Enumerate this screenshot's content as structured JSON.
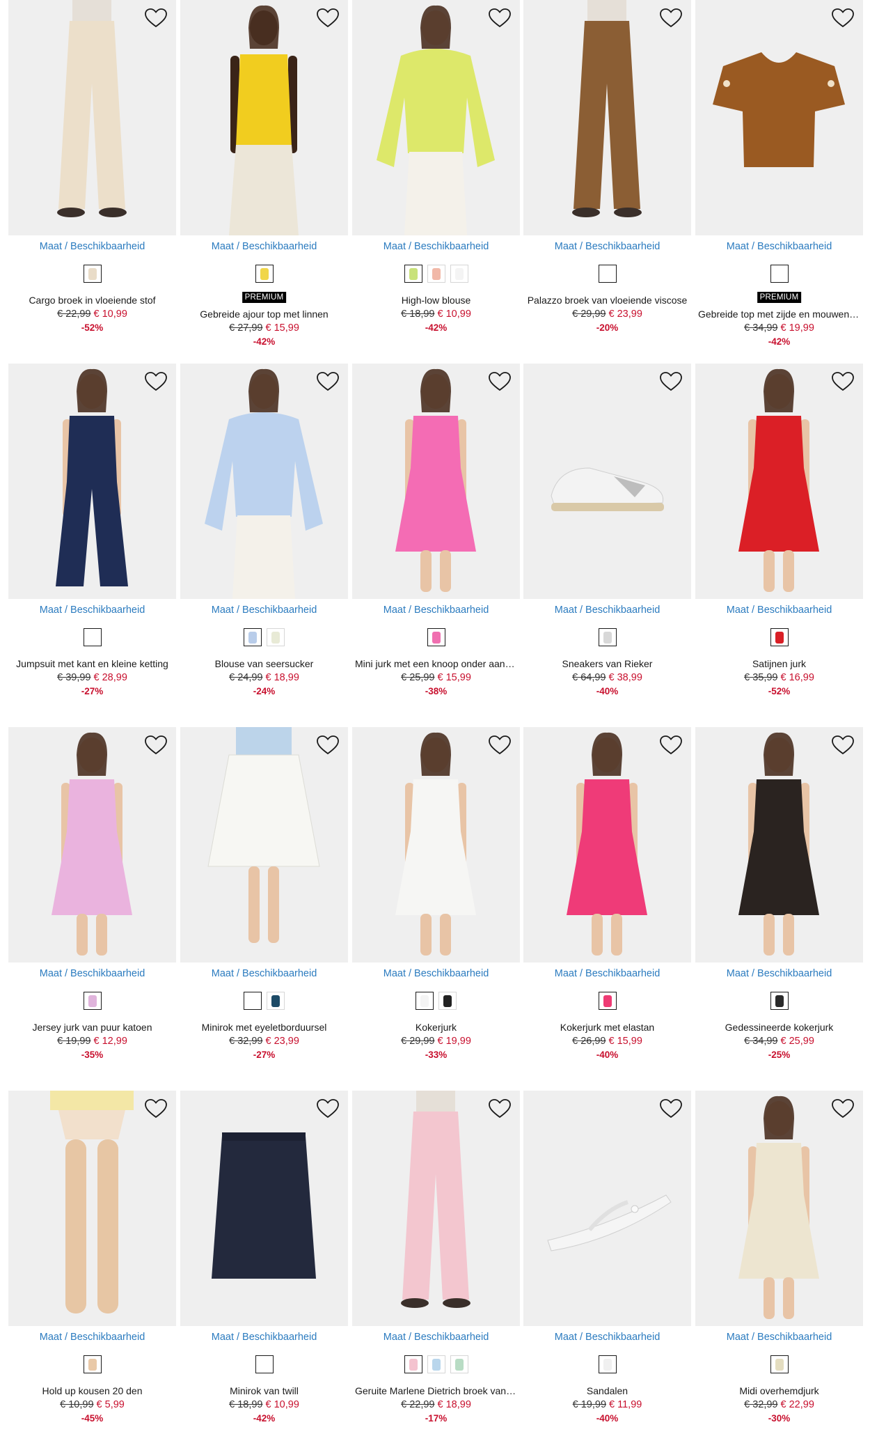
{
  "avail_label": "Maat / Beschikbaarheid",
  "premium_label": "PREMIUM",
  "colors": {
    "link": "#2b7bbf",
    "sale": "#c8102e",
    "image_bg": "#efefef"
  },
  "products": [
    {
      "name": "Cargo broek in vloeiende stof",
      "old": "€ 22,99",
      "new": "€ 10,99",
      "disc": "-52%",
      "premium": false,
      "colors": [
        "#e9dcc8"
      ],
      "fig": {
        "kind": "pants",
        "c": "#ecdfca"
      }
    },
    {
      "name": "Gebreide ajour top met linnen",
      "old": "€ 27,99",
      "new": "€ 15,99",
      "disc": "-42%",
      "premium": true,
      "colors": [
        "#f0d64a"
      ],
      "fig": {
        "kind": "top",
        "c": "#f1cd1f",
        "skin": "#3a2418"
      }
    },
    {
      "name": "High-low blouse",
      "old": "€ 18,99",
      "new": "€ 10,99",
      "disc": "-42%",
      "premium": false,
      "colors": [
        "#c9e27a",
        "#f1b8a8",
        "#f4f4f4"
      ],
      "fig": {
        "kind": "blouse",
        "c": "#dde86a"
      }
    },
    {
      "name": "Palazzo broek van vloeiende viscose",
      "old": "€ 29,99",
      "new": "€ 23,99",
      "disc": "-20%",
      "premium": false,
      "colors": [
        "#ffffff"
      ],
      "fig": {
        "kind": "pants",
        "c": "#8b5e34"
      }
    },
    {
      "name": "Gebreide top met zijde en mouwen met borduursel",
      "old": "€ 34,99",
      "new": "€ 19,99",
      "disc": "-42%",
      "premium": true,
      "colors": [
        "#ffffff"
      ],
      "fig": {
        "kind": "flat",
        "c": "#9a5a22"
      }
    },
    {
      "name": "Jumpsuit met kant en kleine ketting",
      "old": "€ 39,99",
      "new": "€ 28,99",
      "disc": "-27%",
      "premium": false,
      "colors": [
        "#ffffff"
      ],
      "fig": {
        "kind": "jumpsuit",
        "c": "#1f2d55"
      }
    },
    {
      "name": "Blouse van seersucker",
      "old": "€ 24,99",
      "new": "€ 18,99",
      "disc": "-24%",
      "premium": false,
      "colors": [
        "#b9cdea",
        "#e8ead6"
      ],
      "fig": {
        "kind": "blouse",
        "c": "#bcd2ee"
      }
    },
    {
      "name": "Mini jurk met een knoop onder aan de hals",
      "old": "€ 25,99",
      "new": "€ 15,99",
      "disc": "-38%",
      "premium": false,
      "colors": [
        "#f06fb0"
      ],
      "fig": {
        "kind": "dress",
        "c": "#f46cb4"
      }
    },
    {
      "name": "Sneakers van Rieker",
      "old": "€ 64,99",
      "new": "€ 38,99",
      "disc": "-40%",
      "premium": false,
      "colors": [
        "#d8d8d8"
      ],
      "fig": {
        "kind": "shoe",
        "c": "#f3f3f3"
      }
    },
    {
      "name": "Satijnen jurk",
      "old": "€ 35,99",
      "new": "€ 16,99",
      "disc": "-52%",
      "premium": false,
      "colors": [
        "#d91f26"
      ],
      "fig": {
        "kind": "dress",
        "c": "#db1f26"
      }
    },
    {
      "name": "Jersey jurk van puur katoen",
      "old": "€ 19,99",
      "new": "€ 12,99",
      "disc": "-35%",
      "premium": false,
      "colors": [
        "#e0b4dc"
      ],
      "fig": {
        "kind": "dress",
        "c": "#eab3de"
      }
    },
    {
      "name": "Minirok met eyeletborduursel",
      "old": "€ 32,99",
      "new": "€ 23,99",
      "disc": "-27%",
      "premium": false,
      "colors": [
        "#ffffff",
        "#1c4a66"
      ],
      "fig": {
        "kind": "skirt",
        "c": "#f7f7f3"
      }
    },
    {
      "name": "Kokerjurk",
      "old": "€ 29,99",
      "new": "€ 19,99",
      "disc": "-33%",
      "premium": false,
      "colors": [
        "#f4f4f4",
        "#222222"
      ],
      "fig": {
        "kind": "dress",
        "c": "#f6f6f4"
      }
    },
    {
      "name": "Kokerjurk met elastan",
      "old": "€ 26,99",
      "new": "€ 15,99",
      "disc": "-40%",
      "premium": false,
      "colors": [
        "#ee3b74"
      ],
      "fig": {
        "kind": "dress",
        "c": "#ef3b78"
      }
    },
    {
      "name": "Gedessineerde kokerjurk",
      "old": "€ 34,99",
      "new": "€ 25,99",
      "disc": "-25%",
      "premium": false,
      "colors": [
        "#2a2a2a"
      ],
      "fig": {
        "kind": "dress",
        "c": "#2a2320"
      }
    },
    {
      "name": "Hold up kousen 20 den",
      "old": "€ 10,99",
      "new": "€ 5,99",
      "disc": "-45%",
      "premium": false,
      "colors": [
        "#e9c9a8"
      ],
      "fig": {
        "kind": "legs",
        "c": "#e7c6a4"
      }
    },
    {
      "name": "Minirok van twill",
      "old": "€ 18,99",
      "new": "€ 10,99",
      "disc": "-42%",
      "premium": false,
      "colors": [
        "#ffffff"
      ],
      "fig": {
        "kind": "flatskirt",
        "c": "#23293d"
      }
    },
    {
      "name": "Geruite Marlene Dietrich broek van viscose",
      "old": "€ 22,99",
      "new": "€ 18,99",
      "disc": "-17%",
      "premium": false,
      "colors": [
        "#f4c3cf",
        "#b9d6ec",
        "#b8dcc4"
      ],
      "fig": {
        "kind": "pants",
        "c": "#f3c6cf"
      }
    },
    {
      "name": "Sandalen",
      "old": "€ 19,99",
      "new": "€ 11,99",
      "disc": "-40%",
      "premium": false,
      "colors": [
        "#f0f0f0"
      ],
      "fig": {
        "kind": "sandal",
        "c": "#f5f5f5"
      }
    },
    {
      "name": "Midi overhemdjurk",
      "old": "€ 32,99",
      "new": "€ 22,99",
      "disc": "-30%",
      "premium": false,
      "colors": [
        "#e4ddc0"
      ],
      "fig": {
        "kind": "dress",
        "c": "#ede5d0"
      }
    }
  ]
}
